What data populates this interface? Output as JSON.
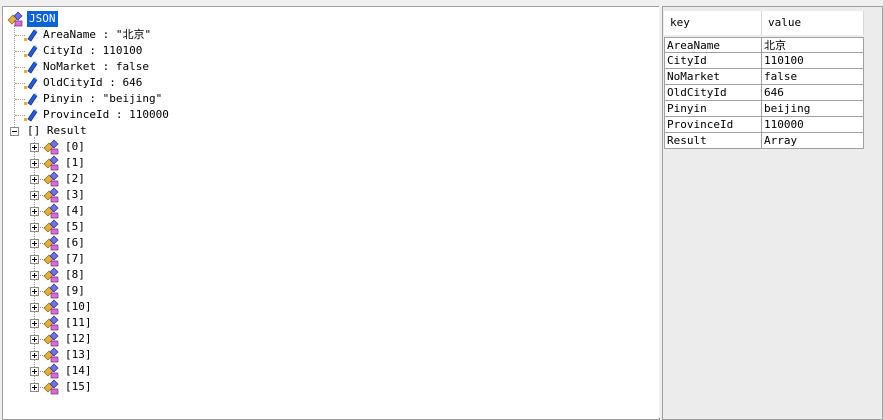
{
  "tree": {
    "root": {
      "label": "JSON"
    },
    "children": [
      {
        "label": "AreaName : \"北京\""
      },
      {
        "label": "CityId : 110100"
      },
      {
        "label": "NoMarket : false"
      },
      {
        "label": "OldCityId : 646"
      },
      {
        "label": "Pinyin : \"beijing\""
      },
      {
        "label": "ProvinceId : 110000"
      }
    ],
    "result": {
      "label": "[] Result"
    },
    "result_items": [
      "[0]",
      "[1]",
      "[2]",
      "[3]",
      "[4]",
      "[5]",
      "[6]",
      "[7]",
      "[8]",
      "[9]",
      "[10]",
      "[11]",
      "[12]",
      "[13]",
      "[14]",
      "[15]"
    ]
  },
  "grid": {
    "headers": {
      "key": "key",
      "value": "value"
    },
    "rows": [
      {
        "key": "AreaName",
        "value": "北京"
      },
      {
        "key": "CityId",
        "value": "110100"
      },
      {
        "key": "NoMarket",
        "value": "false"
      },
      {
        "key": "OldCityId",
        "value": "646"
      },
      {
        "key": "Pinyin",
        "value": "beijing"
      },
      {
        "key": "ProvinceId",
        "value": "110000"
      },
      {
        "key": "Result",
        "value": "Array"
      }
    ]
  },
  "colors": {
    "selection": "#0a64d6",
    "value_icon": "#1f4fcf",
    "array_icon": "#e0b040"
  }
}
